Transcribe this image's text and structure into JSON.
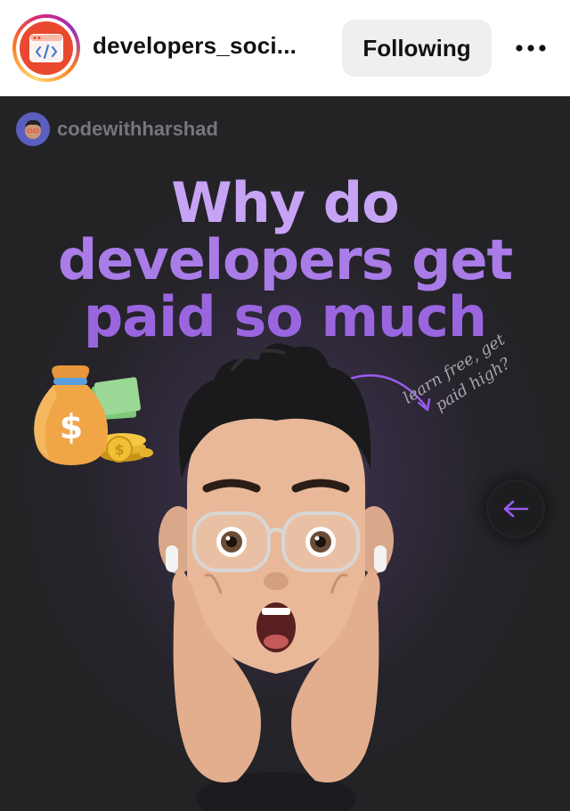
{
  "header": {
    "username": "developers_soci...",
    "follow_label": "Following",
    "avatar_icon": "code-window-icon",
    "more_icon": "more-horizontal-icon"
  },
  "post": {
    "creator_handle": "codewithharshad",
    "headline": [
      "Why do",
      "developers get",
      "paid so much"
    ],
    "doodle_text": [
      "learn free, get",
      "paid high?"
    ],
    "nav_icon": "arrow-left-icon",
    "colors": {
      "headline": "#b88df0",
      "accent_arrow": "#9b5cf0",
      "background": "#26242a"
    }
  }
}
